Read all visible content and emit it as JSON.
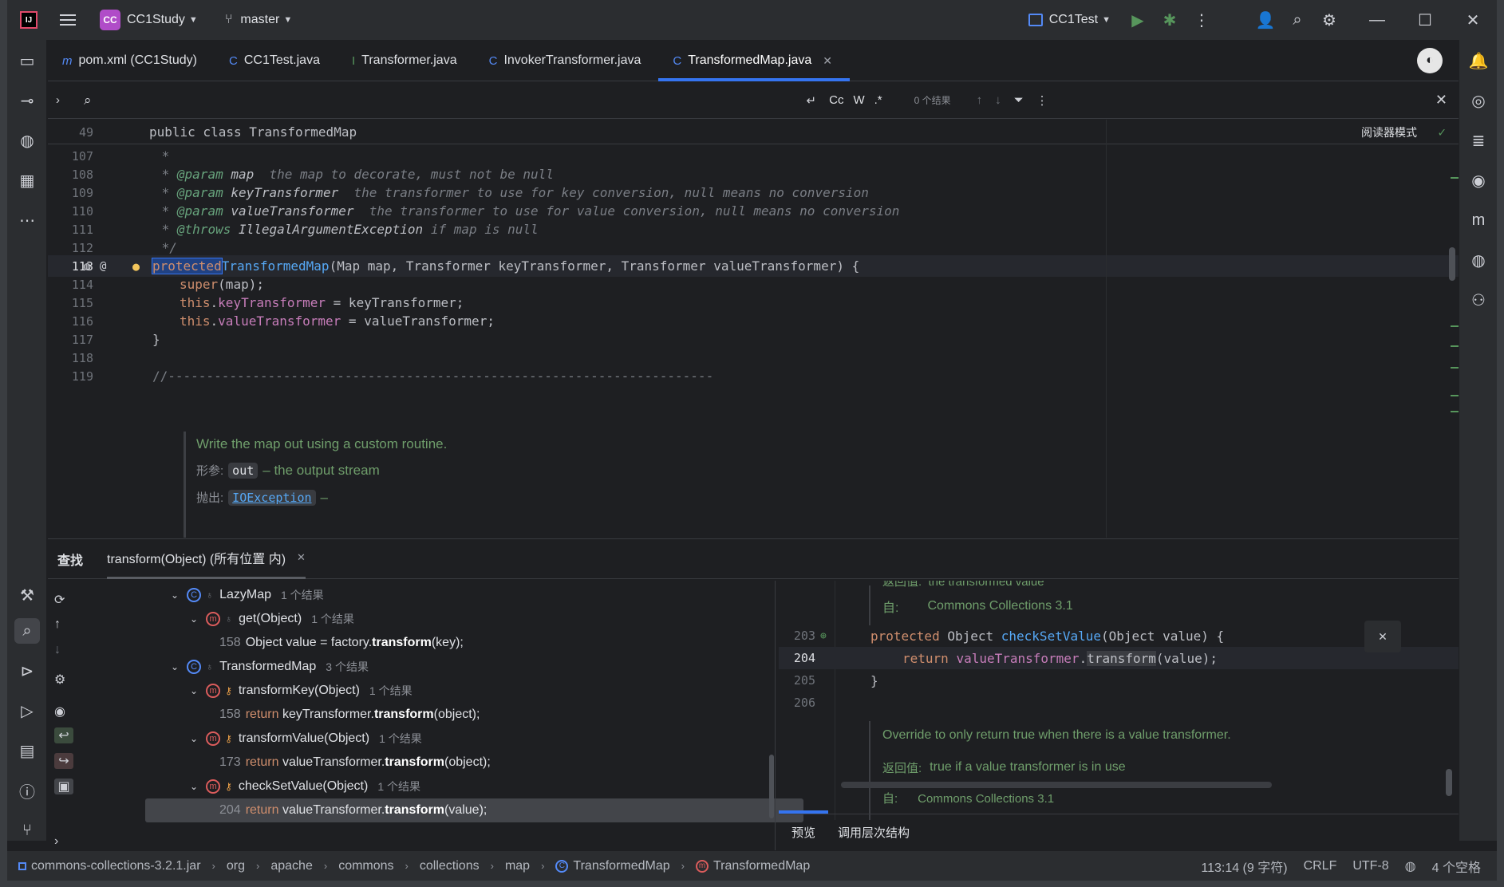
{
  "titlebar": {
    "project_badge": "CC",
    "project": "CC1Study",
    "branch": "master",
    "run_config": "CC1Test"
  },
  "tabs": [
    {
      "icon": "m",
      "label": "pom.xml (CC1Study)"
    },
    {
      "icon": "C",
      "label": "CC1Test.java"
    },
    {
      "icon": "I",
      "label": "Transformer.java"
    },
    {
      "icon": "C",
      "label": "InvokerTransformer.java"
    },
    {
      "icon": "C",
      "label": "TransformedMap.java"
    }
  ],
  "findbar": {
    "case": "Cc",
    "words": "W",
    "regex": ".*",
    "results": "0 个结果"
  },
  "editor": {
    "sticky_line": "49",
    "sticky_text": "public class TransformedMap",
    "reader_mode": "阅读器模式",
    "lines": [
      {
        "n": "107",
        "t": " *"
      },
      {
        "n": "108",
        "a": "@param",
        "b": "map",
        "c": "the map to decorate, must not be null"
      },
      {
        "n": "109",
        "a": "@param",
        "b": "keyTransformer",
        "c": "the transformer to use for key conversion, null means no conversion"
      },
      {
        "n": "110",
        "a": "@param",
        "b": "valueTransformer",
        "c": "the transformer to use for value conversion, null means no conversion"
      },
      {
        "n": "111",
        "a": "@throws",
        "b": "IllegalArgumentException",
        "c": "if map is null"
      },
      {
        "n": "112",
        "t": " */"
      },
      {
        "n": "113"
      },
      {
        "n": "114"
      },
      {
        "n": "115"
      },
      {
        "n": "116"
      },
      {
        "n": "117"
      },
      {
        "n": "118"
      },
      {
        "n": "119",
        "t": "//-----------------------------------------------------------------------"
      }
    ],
    "ctor": {
      "kw": "protected",
      "name": "TransformedMap",
      "params": "(Map map, Transformer keyTransformer, Transformer valueTransformer) {"
    },
    "super_kw": "super",
    "super_rest": "(map);",
    "this_kw": "this",
    "f1": "keyTransformer",
    "a1": " = keyTransformer;",
    "f2": "valueTransformer",
    "a2": " = valueTransformer;",
    "close": "}",
    "doc": {
      "summary": "Write the map out using a custom routine.",
      "param_label": "形参:",
      "param_code": "out",
      "param_desc": "– the output stream",
      "throws_label": "抛出:",
      "throws_code": "IOException",
      "throws_desc": "–"
    }
  },
  "find": {
    "title": "查找",
    "tab": "transform(Object) (所有位置 内)",
    "tree": [
      {
        "kind": "class",
        "label": "LazyMap",
        "count": "1 个结果"
      },
      {
        "kind": "method",
        "label": "get(Object)",
        "count": "1 个结果"
      },
      {
        "kind": "usage",
        "ln": "158",
        "pre": "Object value = factory.",
        "hit": "transform",
        "post": "(key);"
      },
      {
        "kind": "class",
        "label": "TransformedMap",
        "count": "3 个结果"
      },
      {
        "kind": "method",
        "label": "transformKey(Object)",
        "count": "1 个结果"
      },
      {
        "kind": "usage",
        "ln": "158",
        "kw": "return ",
        "pre": "keyTransformer.",
        "hit": "transform",
        "post": "(object);"
      },
      {
        "kind": "method",
        "label": "transformValue(Object)",
        "count": "1 个结果"
      },
      {
        "kind": "usage",
        "ln": "173",
        "kw": "return ",
        "pre": "valueTransformer.",
        "hit": "transform",
        "post": "(object);"
      },
      {
        "kind": "method",
        "label": "checkSetValue(Object)",
        "count": "1 个结果"
      },
      {
        "kind": "usage",
        "ln": "204",
        "kw": "return ",
        "pre": "valueTransformer.",
        "hit": "transform",
        "post": "(value);"
      }
    ],
    "preview": {
      "partial_top": "返回值:  the transformed value",
      "since_label": "自:",
      "since_value": "Commons Collections 3.1",
      "l203": "203",
      "l204": "204",
      "l205": "205",
      "l206": "206",
      "sig_kw": "protected",
      "sig_type": " Object ",
      "sig_fn": "checkSetValue",
      "sig_rest": "(Object value) {",
      "ret_kw": "return",
      "ret_field": "valueTransformer",
      "ret_call": "transform",
      "ret_rest": "(value);",
      "close": "}",
      "doc1": "Override to only return true when there is a value transformer.",
      "doc2_label": "返回值:",
      "doc2": "true if a value transformer is in use",
      "partial_bottom": "自:      Commons Collections 3.1"
    },
    "bottom_tabs": [
      "预览",
      "调用层次结构"
    ]
  },
  "status": {
    "crumbs": [
      "commons-collections-3.2.1.jar",
      "org",
      "apache",
      "commons",
      "collections",
      "map",
      "TransformedMap",
      "TransformedMap"
    ],
    "position": "113:14 (9 字符)",
    "line_sep": "CRLF",
    "encoding": "UTF-8",
    "indent": "4 个空格"
  },
  "colors": {
    "accent": "#3574f0",
    "keyword": "#cf8e6d",
    "function": "#56a8f5",
    "field": "#c77dba"
  }
}
